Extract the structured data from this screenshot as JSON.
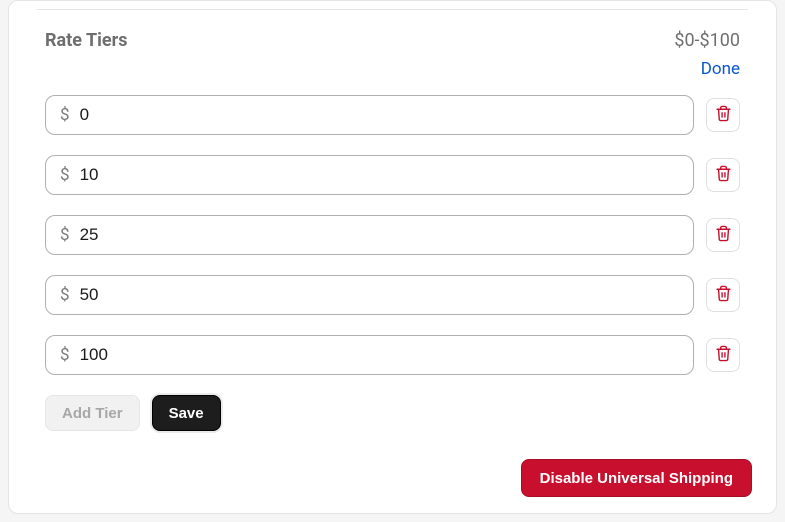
{
  "header": {
    "title": "Rate Tiers",
    "range": "$0-$100",
    "done_label": "Done"
  },
  "currency_symbol": "$",
  "tiers": [
    {
      "value": "0"
    },
    {
      "value": "10"
    },
    {
      "value": "25"
    },
    {
      "value": "50"
    },
    {
      "value": "100"
    }
  ],
  "actions": {
    "add_tier_label": "Add Tier",
    "save_label": "Save"
  },
  "footer": {
    "disable_label": "Disable Universal Shipping"
  },
  "icons": {
    "trash": "trash-icon"
  },
  "colors": {
    "danger": "#c8102e",
    "link": "#0b57d0"
  }
}
